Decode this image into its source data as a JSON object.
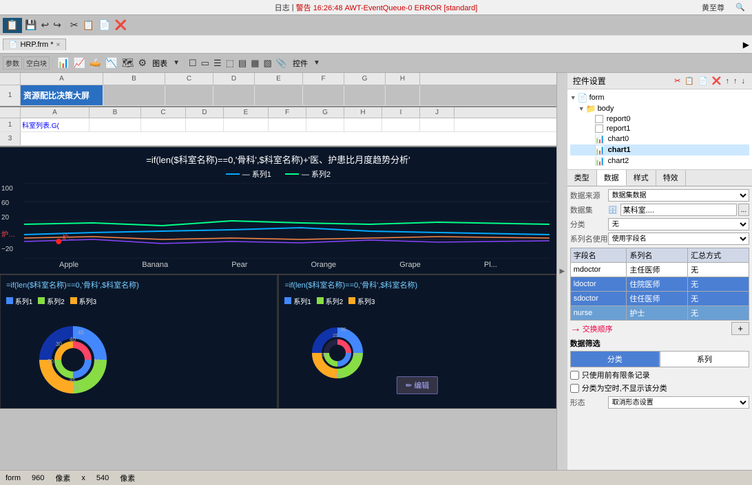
{
  "topbar": {
    "log_label": "日志",
    "warning": "警告",
    "time": "16:26:48",
    "event": "AWT-EventQueue-0 ERROR [standard]",
    "user": "黄至尊"
  },
  "toolbar": {
    "buttons_row1": [
      "💾",
      "↩",
      "↪",
      "✂",
      "📋",
      "📄",
      "❌"
    ],
    "file_tab": "HRP.frm *",
    "close": "×",
    "toggle": "▶"
  },
  "formula_sections": {
    "ref_label": "参数",
    "blank_label": "空白块",
    "chart_label": "图表",
    "control_label": "控件"
  },
  "grid1": {
    "col_letters": [
      "A",
      "B",
      "C",
      "D",
      "E",
      "F",
      "G",
      "H"
    ],
    "row1_cells": [
      "资源配比决策大屏",
      "",
      "",
      "",
      "",
      "",
      "",
      ""
    ],
    "row2_cols": [
      "A",
      "B",
      "C",
      "D",
      "E",
      "F",
      "G",
      "H",
      "I",
      "J"
    ],
    "row2_cells": [
      "科室列表.G(",
      "",
      "",
      "",
      "",
      "",
      "",
      "",
      "",
      ""
    ]
  },
  "chart_main": {
    "title": "=if(len($科室名称)==0,'骨科',$科室名称)+'医、护患比月度趋势分析'",
    "legend": [
      "系列1",
      "系列2"
    ],
    "x_labels": [
      "Apple",
      "Banana",
      "Pear",
      "Orange",
      "Grape",
      "Pl..."
    ],
    "y_labels": [
      "100",
      "60",
      "20",
      "炉…",
      "−20"
    ],
    "series1_color": "#00aaff",
    "series2_color": "#00ff88"
  },
  "bottom_chart_left": {
    "title": "=if(len($科室名称)==0,'骨科',$科室名称)",
    "legend": [
      "系列1",
      "系列2",
      "系列3"
    ],
    "legend_colors": [
      "#4488ff",
      "#88dd44",
      "#ffaa22"
    ],
    "donut_values": [
      "30",
      "40",
      "45",
      "35",
      "50",
      "15",
      "85"
    ]
  },
  "bottom_chart_right": {
    "title": "=if(len($科室名称)==0,'骨科',$科室名称)",
    "legend": [
      "系列1",
      "系列2",
      "系列3"
    ],
    "legend_colors": [
      "#4488ff",
      "#88dd44",
      "#ffaa22"
    ],
    "edit_btn": "✏ 编辑",
    "donut_values": [
      "35",
      "40",
      "45",
      "50",
      "15"
    ]
  },
  "right_panel": {
    "title": "控件设置",
    "tree": {
      "items": [
        {
          "label": "form",
          "indent": 0,
          "icon": "form",
          "expanded": true
        },
        {
          "label": "body",
          "indent": 1,
          "icon": "body",
          "expanded": true
        },
        {
          "label": "report0",
          "indent": 2,
          "icon": "report"
        },
        {
          "label": "report1",
          "indent": 2,
          "icon": "report"
        },
        {
          "label": "chart0",
          "indent": 2,
          "icon": "chart"
        },
        {
          "label": "chart1",
          "indent": 2,
          "icon": "chart",
          "selected": true
        },
        {
          "label": "chart2",
          "indent": 2,
          "icon": "chart"
        }
      ]
    },
    "props_tabs": [
      "类型",
      "数据",
      "样式",
      "特效"
    ],
    "active_tab": "数据",
    "properties": {
      "datasource_label": "数据来源",
      "datasource_value": "数据集数据",
      "dataset_label": "数据集",
      "dataset_value": "某科室....",
      "category_label": "分类",
      "category_value": "无",
      "series_label": "系列名使用",
      "series_value": "使用字段名",
      "table_headers": [
        "字段名",
        "系列名",
        "汇总方式"
      ],
      "table_rows": [
        {
          "field": "mdoctor",
          "series": "主任医师",
          "agg": "无",
          "selected": false
        },
        {
          "field": "ldoctor",
          "series": "住院医师",
          "agg": "无",
          "selected": true
        },
        {
          "field": "sdoctor",
          "series": "住任医师",
          "agg": "无",
          "selected": true
        },
        {
          "field": "nurse",
          "series": "护士",
          "agg": "无",
          "selected": false,
          "nurse": true
        }
      ],
      "add_btn": "+",
      "exchange_label": "交换顺序",
      "filter_label": "数据筛选",
      "filter_tabs": [
        "分类",
        "系列"
      ],
      "checkbox1": "只使用前有限条记录",
      "checkbox2": "分类为空时,不显示该分类",
      "form_label": "形态",
      "form_value": "取消形态设置"
    }
  },
  "statusbar": {
    "form_label": "form",
    "x_label": "像素",
    "x_val": "960",
    "y_label": "像素",
    "y_val": "540"
  }
}
